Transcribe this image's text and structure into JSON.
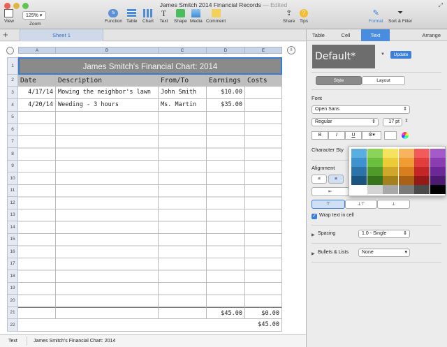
{
  "window": {
    "title": "James Smitch 2014 Financial Records",
    "edited": "— Edited"
  },
  "toolbar": {
    "view": "View",
    "zoom_value": "125%",
    "zoom": "Zoom",
    "function": "Function",
    "table": "Table",
    "chart": "Chart",
    "text": "Text",
    "shape": "Shape",
    "media": "Media",
    "comment": "Comment",
    "share": "Share",
    "tips": "Tips",
    "format": "Format",
    "sort_filter": "Sort & Filter"
  },
  "sheet": {
    "tab": "Sheet 1"
  },
  "columns": [
    "A",
    "B",
    "C",
    "D",
    "E"
  ],
  "rows": [
    "1",
    "2",
    "3",
    "4",
    "5",
    "6",
    "7",
    "8",
    "9",
    "10",
    "11",
    "12",
    "13",
    "14",
    "15",
    "16",
    "17",
    "18",
    "19",
    "20",
    "21",
    "22"
  ],
  "table": {
    "title": "James Smitch's Financial Chart: 2014",
    "headers": [
      "Date",
      "Description",
      "From/To",
      "Earnings",
      "Costs"
    ],
    "rows": [
      [
        "4/17/14",
        "Mowing the neighbor's lawn",
        "John Smith",
        "$10.00",
        ""
      ],
      [
        "4/20/14",
        "Weeding - 3 hours",
        "Ms. Martin",
        "$35.00",
        ""
      ]
    ],
    "sum_earnings": "$45.00",
    "sum_costs": "$0.00",
    "total": "$45.00"
  },
  "status": {
    "type": "Text",
    "selection": "James Smitch's Financial Chart: 2014"
  },
  "inspector": {
    "tabs": [
      "Table",
      "Cell",
      "Text",
      "Arrange"
    ],
    "style_name": "Default*",
    "update": "Update",
    "subtabs": [
      "Style",
      "Layout"
    ],
    "font_label": "Font",
    "font_name": "Open Sans",
    "font_style": "Regular",
    "font_size": "17 pt",
    "bold": "B",
    "italic": "I",
    "underline": "U",
    "gear": "⚙▾",
    "char_style": "Character Sty",
    "alignment": "Alignment",
    "wrap": "Wrap text in cell",
    "spacing": "Spacing",
    "spacing_value": "1.0 - Single",
    "bullets": "Bullets & Lists",
    "bullets_value": "None"
  },
  "palette_colors": [
    [
      "#5aaee0",
      "#8cd35a",
      "#f5e25e",
      "#f7b35d",
      "#f25b5b",
      "#a35bc8"
    ],
    [
      "#3d92cf",
      "#6cbf3c",
      "#eccb39",
      "#ef9c35",
      "#e23d3d",
      "#8a3db0"
    ],
    [
      "#2a74ab",
      "#4f9a2a",
      "#d0a829",
      "#d77f1d",
      "#c32626",
      "#6b2896"
    ],
    [
      "#1a5581",
      "#36741b",
      "#a3821c",
      "#ab6114",
      "#951919",
      "#4d1a72"
    ],
    [
      "#ffffff",
      "#d4d4d4",
      "#a8a8a8",
      "#7a7a7a",
      "#4a4a4a",
      "#000000"
    ]
  ]
}
